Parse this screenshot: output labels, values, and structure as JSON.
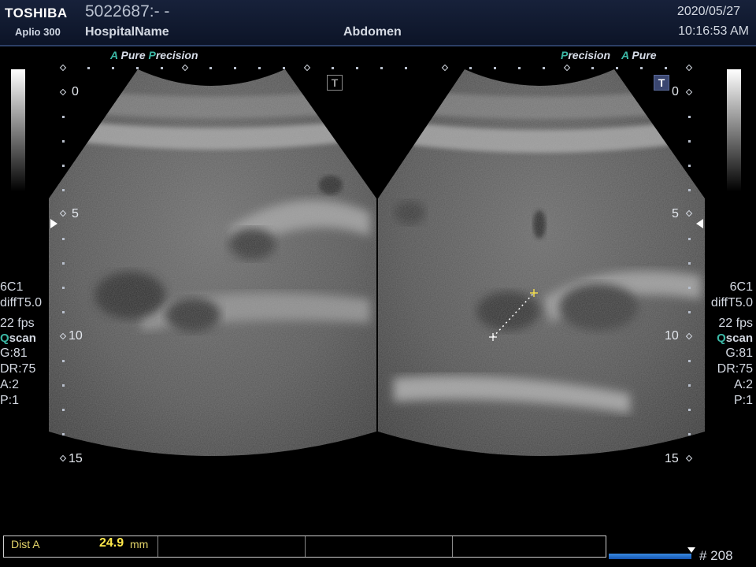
{
  "header": {
    "brand": "TOSHIBA",
    "model": "Aplio 300",
    "patient_id": "5022687:- -",
    "hospital": "HospitalName",
    "exam": "Abdomen",
    "date": "2020/05/27",
    "time": "10:16:53 AM"
  },
  "left_panel": {
    "tag_a": "A",
    "tag_pure": "Pure",
    "tag_p": "P",
    "tag_precision": "recision",
    "t_mark": "T",
    "params": {
      "probe": "6C1",
      "mode": "diffT5.0",
      "fps": "22 fps",
      "q": "Q",
      "scan": "scan",
      "gain": "G:81",
      "dr": "DR:75",
      "a": "A:2",
      "p": "P:1"
    },
    "depths": [
      "0",
      "5",
      "10",
      "15"
    ]
  },
  "right_panel": {
    "tag_p": "P",
    "tag_precision": "recision",
    "tag_a": "A",
    "tag_pure": "Pure",
    "t_mark": "T",
    "params": {
      "probe": "6C1",
      "mode": "diffT5.0",
      "fps": "22 fps",
      "q": "Q",
      "scan": "scan",
      "gain": "G:81",
      "dr": "DR:75",
      "a": "A:2",
      "p": "P:1"
    },
    "depths": [
      "0",
      "5",
      "10",
      "15"
    ]
  },
  "measurement": {
    "label": "Dist A",
    "value": "24.9",
    "unit": "mm"
  },
  "cine": {
    "frame": "# 208"
  }
}
